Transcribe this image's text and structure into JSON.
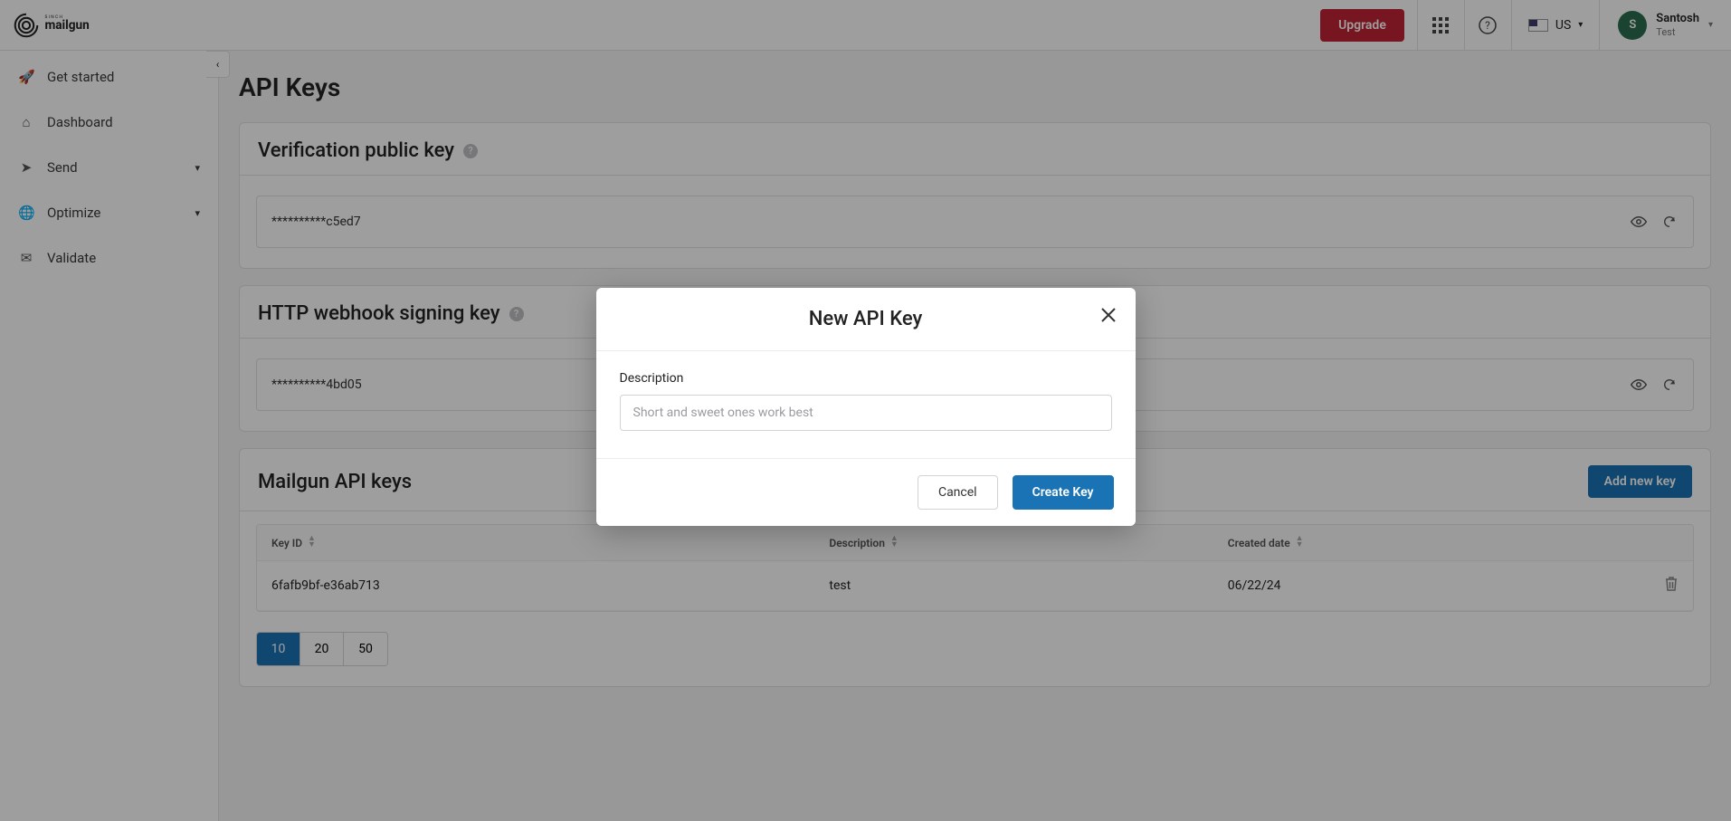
{
  "header": {
    "upgrade_label": "Upgrade",
    "region_label": "US",
    "account_name": "Santosh",
    "account_sub": "Test",
    "account_initial": "S"
  },
  "sidebar": {
    "items": [
      {
        "label": "Get started",
        "icon": "rocket-icon",
        "expandable": false
      },
      {
        "label": "Dashboard",
        "icon": "home-icon",
        "expandable": false
      },
      {
        "label": "Send",
        "icon": "send-icon",
        "expandable": true
      },
      {
        "label": "Optimize",
        "icon": "globe-icon",
        "expandable": true
      },
      {
        "label": "Validate",
        "icon": "validate-icon",
        "expandable": false
      }
    ]
  },
  "page": {
    "title": "API Keys",
    "verification": {
      "title": "Verification public key",
      "value": "**********c5ed7"
    },
    "webhook": {
      "title": "HTTP webhook signing key",
      "value": "**********4bd05"
    },
    "mailgun": {
      "title": "Mailgun API keys",
      "add_label": "Add new key",
      "columns": {
        "id": "Key ID",
        "desc": "Description",
        "date": "Created date"
      },
      "rows": [
        {
          "id": "6fafb9bf-e36ab713",
          "desc": "test",
          "date": "06/22/24"
        }
      ],
      "page_sizes": [
        "10",
        "20",
        "50"
      ],
      "active_page_size": "10"
    }
  },
  "modal": {
    "title": "New API Key",
    "field_label": "Description",
    "placeholder": "Short and sweet ones work best",
    "cancel_label": "Cancel",
    "create_label": "Create Key"
  }
}
